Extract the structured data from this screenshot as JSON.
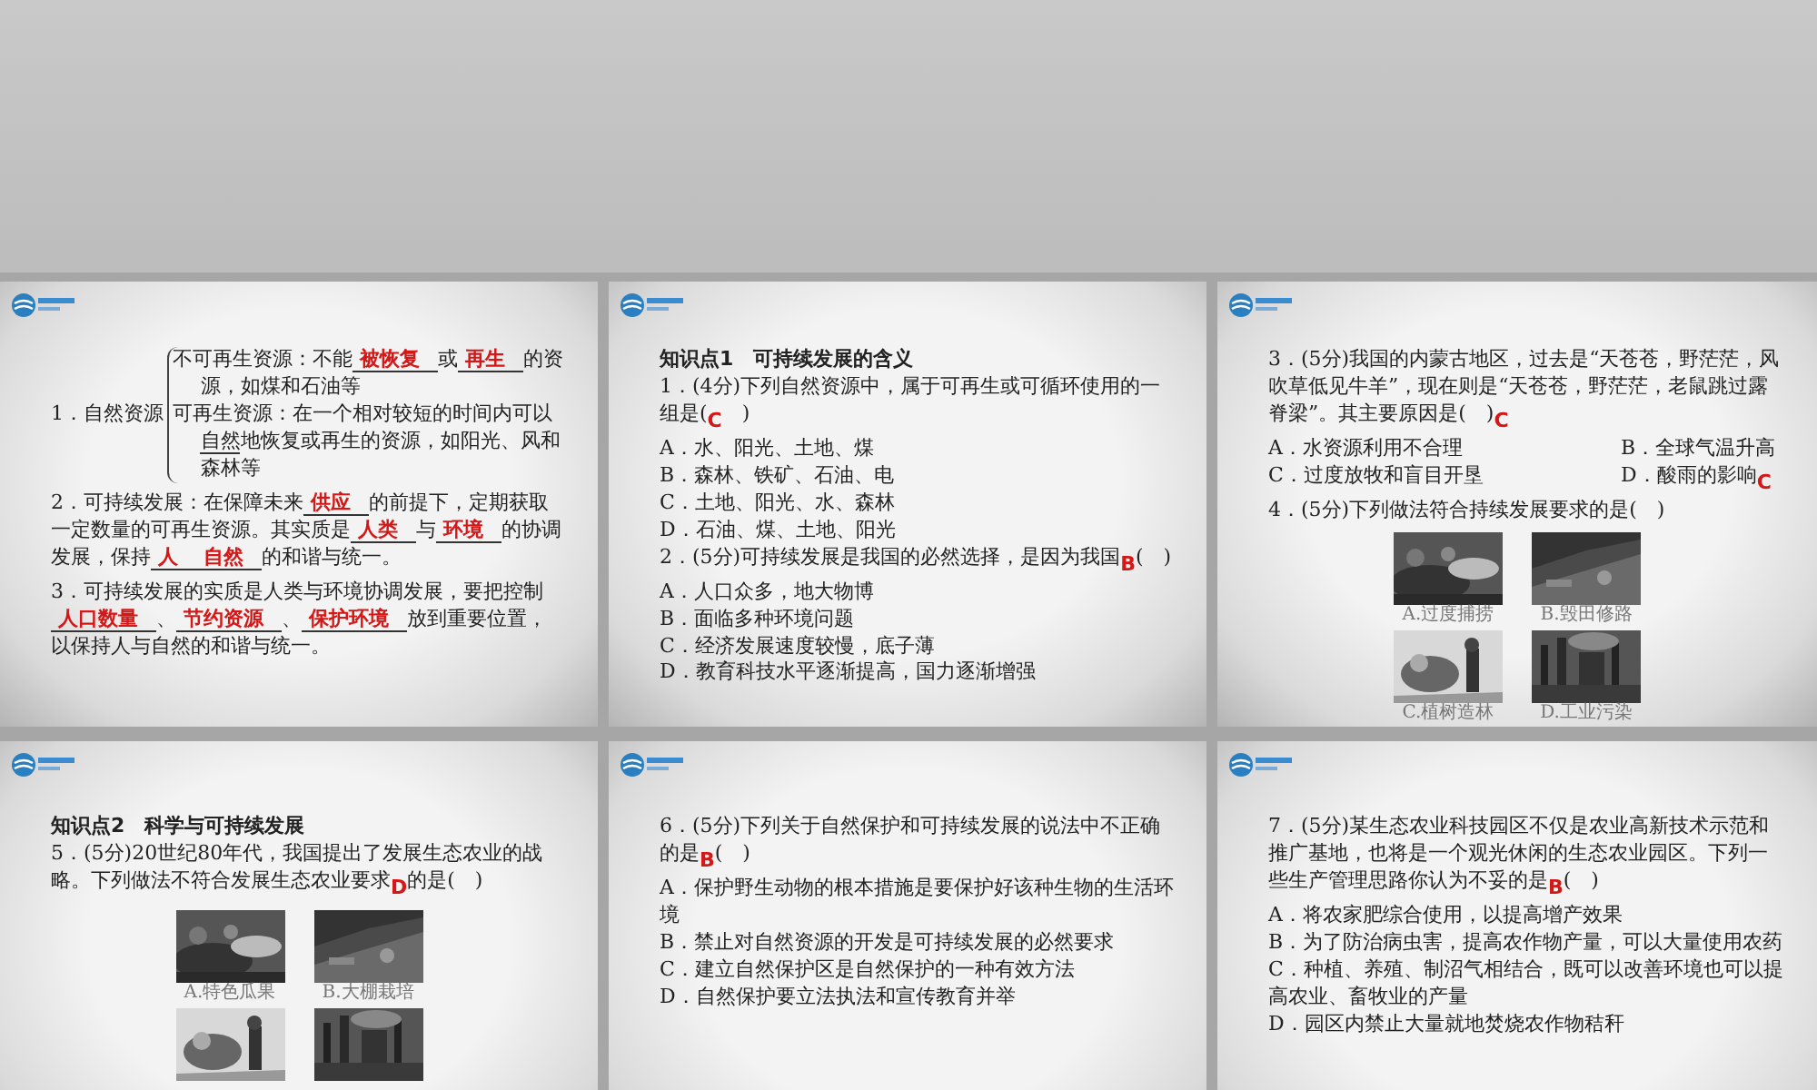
{
  "slides": [
    {
      "blocks": [
        {
          "kind": "brace",
          "label": "1．自然资源",
          "items": [
            [
              "不可再生资源：不能",
              {
                "kind": "answer",
                "text": "被恢复"
              },
              "或",
              {
                "kind": "answer",
                "text": "再生"
              },
              "的资源，如煤和石油等"
            ],
            [
              "可再生资源：在一个相对较短的时间内可以",
              {
                "kind": "underline",
                "text": "自然"
              },
              "地恢复或再生的资源，如阳光、风和森林等"
            ]
          ]
        },
        {
          "kind": "note",
          "segments": [
            "2．可持续发展：在保障未来",
            {
              "kind": "answer",
              "text": "供应"
            },
            "的前提下，定期获取一定数量的可再生资源。其实质是",
            {
              "kind": "answer",
              "text": "人类"
            },
            "与",
            {
              "kind": "answer",
              "text": "环境"
            },
            "的协调发展，保持",
            {
              "kind": "answer",
              "text": "人"
            },
            {
              "kind": "answer",
              "text": "自然"
            },
            "的和谐与统一。"
          ]
        },
        {
          "kind": "note",
          "segments": [
            "3．可持续发展的实质是人类与环境协调发展，要把控制",
            {
              "kind": "answer",
              "text": "人口数量"
            },
            "、",
            {
              "kind": "answer",
              "text": "节约资源"
            },
            "、",
            {
              "kind": "answer",
              "text": "保护环境"
            },
            "放到重要位置，以保持人与自然的和谐与统一。"
          ]
        }
      ]
    },
    {
      "blocks": [
        {
          "kind": "heading",
          "text": "知识点1　可持续发展的含义"
        },
        {
          "kind": "question",
          "segments": [
            "1．(4分)下列自然资源中，属于可再生或可循环使用的一组是(",
            {
              "kind": "mark",
              "text": "C"
            },
            "　)"
          ]
        },
        {
          "kind": "option",
          "segments": [
            "A．水、阳光、土地、煤"
          ]
        },
        {
          "kind": "option",
          "segments": [
            "B．森林、铁矿、石油、电"
          ]
        },
        {
          "kind": "option",
          "segments": [
            "C．土地、阳光、水、森林"
          ]
        },
        {
          "kind": "option",
          "segments": [
            "D．石油、煤、土地、阳光"
          ]
        },
        {
          "kind": "question",
          "segments": [
            "2．(5分)可持续发展是我国的必然选择，是因为我国",
            {
              "kind": "mark",
              "text": "B"
            },
            "(　)"
          ]
        },
        {
          "kind": "option",
          "segments": [
            "A．人口众多，地大物博"
          ]
        },
        {
          "kind": "option",
          "segments": [
            "B．面临多种环境问题"
          ]
        },
        {
          "kind": "option",
          "segments": [
            "C．经济发展速度较慢，底子薄"
          ]
        },
        {
          "kind": "option",
          "segments": [
            "D．教育科技水平逐渐提高，国力逐渐增强"
          ]
        }
      ]
    },
    {
      "blocks": [
        {
          "kind": "question",
          "segments": [
            "3．(5分)我国的内蒙古地区，过去是“天苍苍，野茫茫，风吹草低见牛羊”，现在则是“天苍苍，野茫茫，老鼠跳过露脊梁”。其主要原因是(　)",
            {
              "kind": "mark",
              "text": "C"
            }
          ]
        },
        {
          "kind": "pair",
          "items": [
            [
              "A．水资源利用不合理"
            ],
            [
              "B．全球气温升高"
            ]
          ]
        },
        {
          "kind": "pair",
          "items": [
            [
              "C．过度放牧和盲目开垦"
            ],
            [
              "D．酸雨的影响",
              {
                "kind": "mark",
                "text": "C"
              }
            ]
          ]
        },
        {
          "kind": "question",
          "segments": [
            "4．(5分)下列做法符合持续发展要求的是(　)"
          ]
        },
        {
          "kind": "figures",
          "items": [
            {
              "kind": "picture",
              "caption": "A.过度捕捞"
            },
            {
              "kind": "picture",
              "caption": "B.毁田修路"
            },
            {
              "kind": "picture",
              "caption": "C.植树造林"
            },
            {
              "kind": "picture",
              "caption": "D.工业污染"
            }
          ]
        }
      ]
    },
    {
      "blocks": [
        {
          "kind": "heading",
          "text": "知识点2　科学与可持续发展"
        },
        {
          "kind": "question",
          "segments": [
            "5．(5分)20世纪80年代，我国提出了发展生态农业的战略。下列做法不符合发展生态农业要求",
            {
              "kind": "mark",
              "text": "D"
            },
            "的是(　)"
          ]
        },
        {
          "kind": "figures",
          "items": [
            {
              "kind": "picture",
              "caption": "A.特色瓜果"
            },
            {
              "kind": "picture",
              "caption": "B.大棚栽培"
            },
            {
              "kind": "picture"
            },
            {
              "kind": "picture"
            }
          ]
        }
      ]
    },
    {
      "blocks": [
        {
          "kind": "question",
          "segments": [
            "6．(5分)下列关于自然保护和可持续发展的说法中不正确的是",
            {
              "kind": "mark",
              "text": "B"
            },
            "(　)"
          ]
        },
        {
          "kind": "option",
          "segments": [
            "A．保护野生动物的根本措施是要保护好该种生物的生活环境"
          ]
        },
        {
          "kind": "option",
          "segments": [
            "B．禁止对自然资源的开发是可持续发展的必然要求"
          ]
        },
        {
          "kind": "option",
          "segments": [
            "C．建立自然保护区是自然保护的一种有效方法"
          ]
        },
        {
          "kind": "option",
          "segments": [
            "D．自然保护要立法执法和宣传教育并举"
          ]
        }
      ]
    },
    {
      "blocks": [
        {
          "kind": "question",
          "segments": [
            "7．(5分)某生态农业科技园区不仅是农业高新技术示范和推广基地，也将是一个观光休闲的生态农业园区。下列一些生产管理思路你认为不妥的是",
            {
              "kind": "mark",
              "text": "B"
            },
            "(　)"
          ]
        },
        {
          "kind": "option",
          "segments": [
            "A．将农家肥综合使用，以提高增产效果"
          ]
        },
        {
          "kind": "option",
          "segments": [
            "B．为了防治病虫害，提高农作物产量，可以大量使用农药"
          ]
        },
        {
          "kind": "option",
          "segments": [
            "C．种植、养殖、制沼气相结合，既可以改善环境也可以提高农业、畜牧业的产量"
          ]
        },
        {
          "kind": "option",
          "segments": [
            "D．园区内禁止大量就地焚烧农作物秸秆"
          ]
        }
      ]
    }
  ]
}
